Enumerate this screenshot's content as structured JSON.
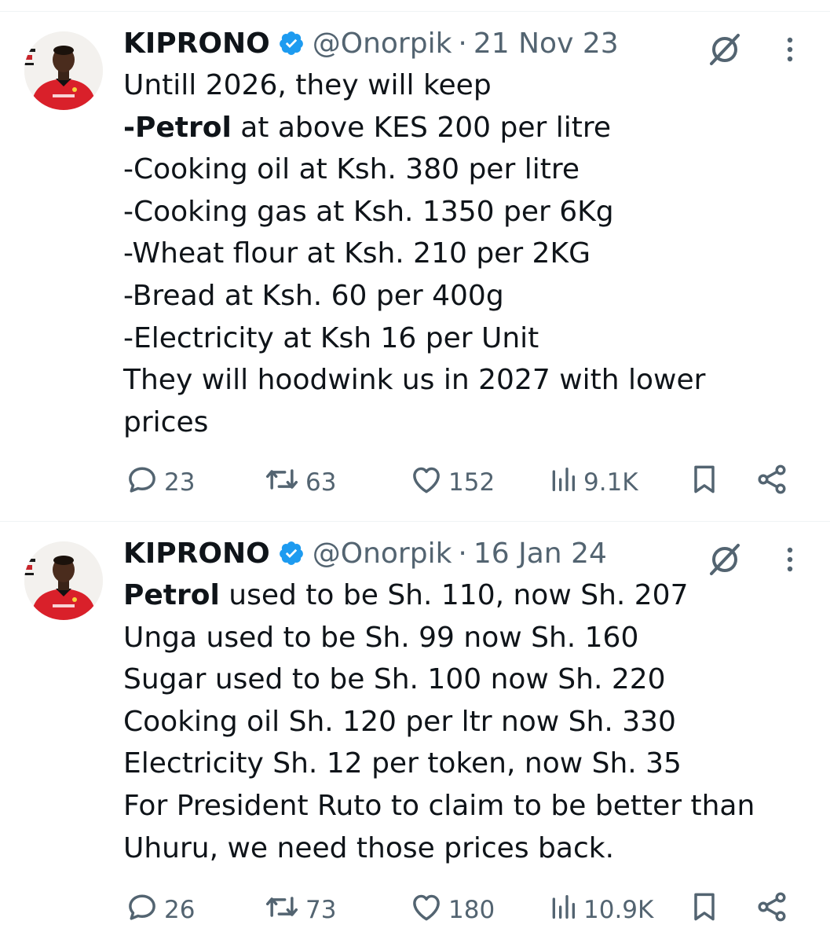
{
  "tweets": [
    {
      "display_name": "KIPRONO",
      "handle": "@Onorpik",
      "separator": "·",
      "date": "21 Nov 23",
      "lines": [
        {
          "bold": "",
          "text": "Untill 2026, they will keep"
        },
        {
          "bold": "-Petrol",
          "text": " at above KES 200 per litre"
        },
        {
          "bold": "",
          "text": "-Cooking oil at Ksh. 380 per litre"
        },
        {
          "bold": "",
          "text": "-Cooking gas at Ksh. 1350 per 6Kg"
        },
        {
          "bold": "",
          "text": "-Wheat flour at Ksh. 210 per 2KG"
        },
        {
          "bold": "",
          "text": "-Bread at Ksh. 60 per 400g"
        },
        {
          "bold": "",
          "text": "-Electricity at Ksh 16 per Unit"
        },
        {
          "bold": "",
          "text": "They will hoodwink us in 2027 with lower"
        },
        {
          "bold": "",
          "text": "prices"
        }
      ],
      "replies": "23",
      "reposts": "63",
      "likes": "152",
      "views": "9.1K"
    },
    {
      "display_name": "KIPRONO",
      "handle": "@Onorpik",
      "separator": "·",
      "date": "16 Jan 24",
      "lines": [
        {
          "bold": "Petrol",
          "text": " used to be Sh. 110, now Sh. 207"
        },
        {
          "bold": "",
          "text": "Unga used to be Sh. 99 now Sh. 160"
        },
        {
          "bold": "",
          "text": "Sugar used to be Sh. 100 now Sh. 220"
        },
        {
          "bold": "",
          "text": "Cooking oil Sh. 120 per ltr now Sh. 330"
        },
        {
          "bold": "",
          "text": "Electricity Sh. 12 per token, now Sh. 35"
        },
        {
          "bold": "",
          "text": "For President Ruto to claim to be better than"
        },
        {
          "bold": "",
          "text": "Uhuru, we need those prices back."
        }
      ],
      "replies": "26",
      "reposts": "73",
      "likes": "180",
      "views": "10.9K"
    }
  ],
  "icons": {
    "verified": "verified-badge-icon",
    "grok": "grok-icon",
    "more": "more-icon",
    "reply": "reply-icon",
    "repost": "repost-icon",
    "like": "heart-icon",
    "views": "views-icon",
    "bookmark": "bookmark-icon",
    "share": "share-icon"
  },
  "colors": {
    "text": "#0f1419",
    "muted": "#536471",
    "verified": "#1d9bf0",
    "divider": "#eff3f4",
    "shirt_red": "#d9202a"
  }
}
